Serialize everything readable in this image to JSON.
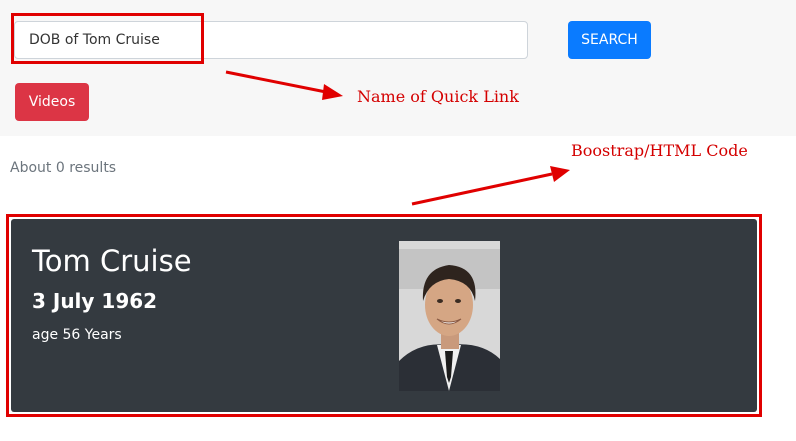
{
  "search": {
    "value": "DOB of Tom Cruise",
    "button_label": "SEARCH"
  },
  "quick_links": {
    "videos_label": "Videos"
  },
  "annotations": {
    "quick_link": "Name of Quick Link",
    "code": "Boostrap/HTML Code"
  },
  "results": {
    "summary": "About 0 results"
  },
  "card": {
    "name": "Tom Cruise",
    "dob": "3 July 1962",
    "age": "age 56 Years",
    "image_icon": "portrait-photo"
  },
  "colors": {
    "primary": "#0a7bff",
    "danger": "#dc3545",
    "card_bg": "#343a40",
    "annotation": "#d40000",
    "topbar_bg": "#f7f7f7"
  }
}
